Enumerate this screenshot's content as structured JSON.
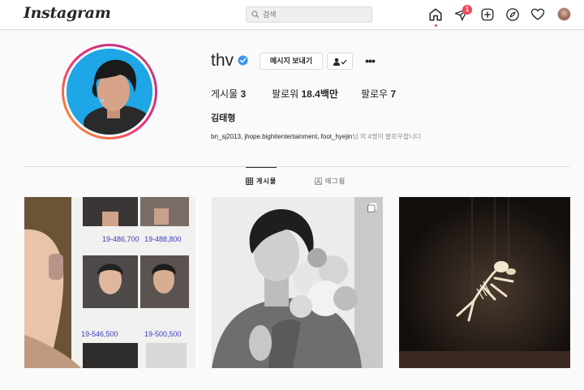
{
  "app": {
    "logo": "Instagram"
  },
  "search": {
    "placeholder": "검색"
  },
  "nav": {
    "icons": [
      "home-icon",
      "direct-icon",
      "new-post-icon",
      "explore-icon",
      "activity-icon"
    ],
    "direct_badge": "1"
  },
  "profile": {
    "username": "thv",
    "verified": true,
    "message_label": "메시지 보내기",
    "stats": {
      "posts_label": "게시물",
      "posts_value": "3",
      "followers_label": "팔로워",
      "followers_value": "18.4백만",
      "following_label": "팔로우",
      "following_value": "7"
    },
    "full_name": "김태형",
    "followed_by_names": "bn_sj2013, jhope.bighitentertainment, foot_hyejin",
    "followed_by_suffix": "님 외 4명이 팔로우합니다"
  },
  "tabs": [
    {
      "label": "게시물",
      "active": true
    },
    {
      "label": "태그됨",
      "active": false
    }
  ],
  "colors": {
    "accent": "#0095f6",
    "badge": "#ed4956",
    "border": "#dbdbdb"
  }
}
